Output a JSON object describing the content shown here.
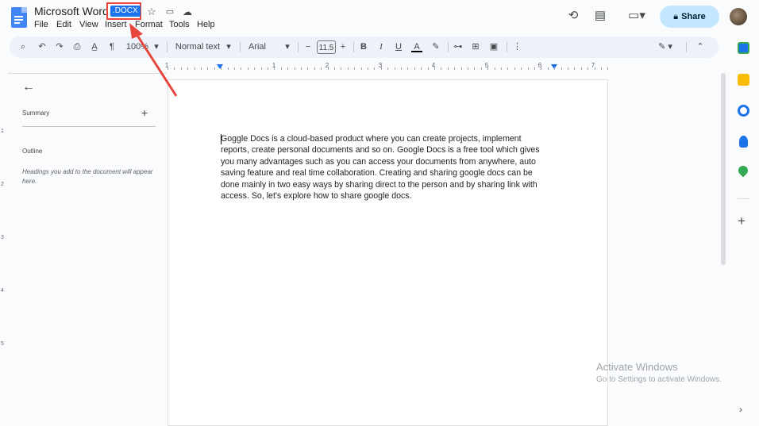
{
  "header": {
    "title": "Microsoft Word",
    "badge": ".DOCX",
    "share_label": "Share"
  },
  "menu": [
    "File",
    "Edit",
    "View",
    "Insert",
    "Format",
    "Tools",
    "Help"
  ],
  "toolbar": {
    "zoom": "100%",
    "style": "Normal text",
    "font": "Arial",
    "font_size": "11.5"
  },
  "ruler": {
    "numbers": [
      "1",
      "1",
      "2",
      "3",
      "4",
      "5",
      "6",
      "7"
    ]
  },
  "vruler": {
    "numbers": [
      "1",
      "2",
      "3",
      "4",
      "5"
    ]
  },
  "left_panel": {
    "summary": "Summary",
    "outline": "Outline",
    "outline_hint": "Headings you add to the document will appear here."
  },
  "document": {
    "body": "Goggle Docs is a cloud-based product where you can create projects, implement reports, create personal documents and so on. Google Docs is a free tool which gives you many advantages such as you can access your documents from anywhere, auto saving feature and real time collaboration. Creating and sharing google docs can be done mainly in two easy ways by sharing direct to the person and by sharing link with access. So, let's explore how to share google docs."
  },
  "watermark": {
    "line1": "Activate Windows",
    "line2": "Go to Settings to activate Windows."
  },
  "colors": {
    "accent": "#1a73e8",
    "share_bg": "#c2e7ff",
    "annotation": "#e8453c"
  },
  "icons": {
    "calendar": "calendar-icon",
    "keep": "keep-icon",
    "tasks": "tasks-icon",
    "contacts": "contacts-icon",
    "maps": "maps-icon"
  }
}
